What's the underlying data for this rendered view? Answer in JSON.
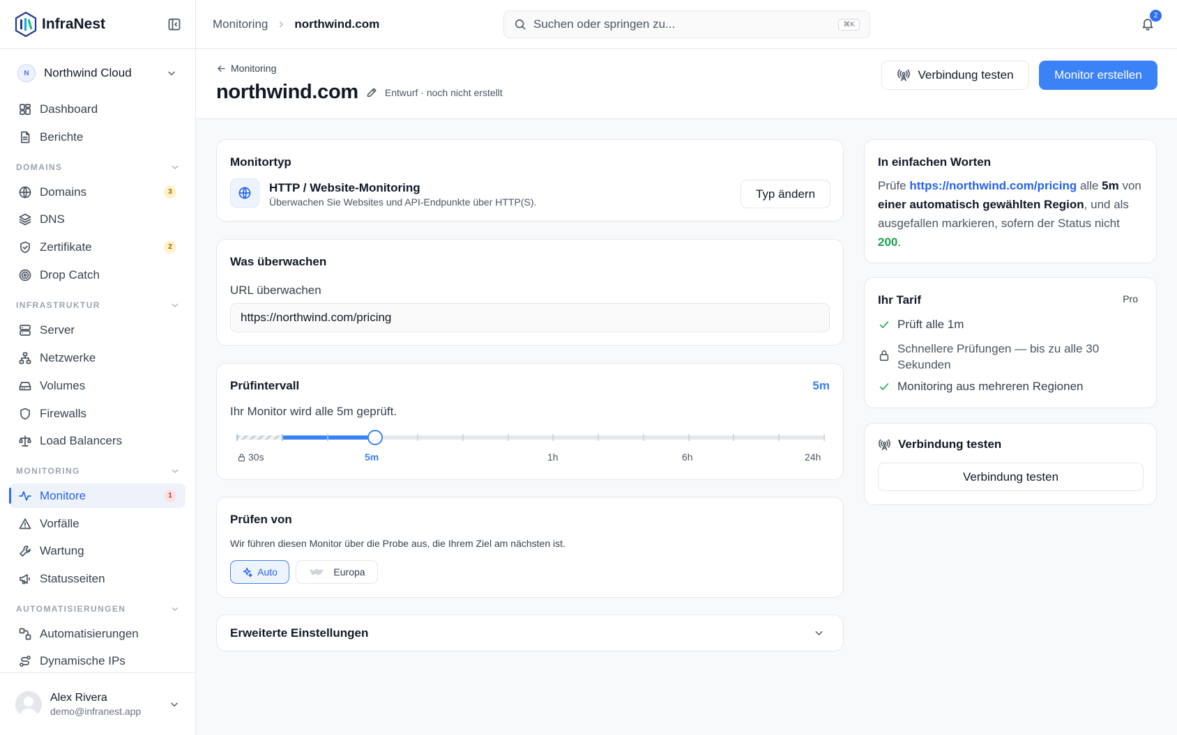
{
  "brand": {
    "name": "InfraNest"
  },
  "org": {
    "initial": "N",
    "name": "Northwind Cloud"
  },
  "nav": {
    "dashboard": "Dashboard",
    "reports": "Berichte",
    "domains_section": "DOMAINS",
    "domains": "Domains",
    "domains_badge": "3",
    "dns": "DNS",
    "certs": "Zertifikate",
    "certs_badge": "2",
    "dropcatch": "Drop Catch",
    "infra_section": "INFRASTRUKTUR",
    "server": "Server",
    "networks": "Netzwerke",
    "volumes": "Volumes",
    "firewalls": "Firewalls",
    "lb": "Load Balancers",
    "monitoring_section": "MONITORING",
    "monitors": "Monitore",
    "monitors_badge": "1",
    "incidents": "Vorfälle",
    "maintenance": "Wartung",
    "statuspages": "Statusseiten",
    "auto_section": "AUTOMATISIERUNGEN",
    "automations": "Automatisierungen",
    "dynips": "Dynamische IPs"
  },
  "user": {
    "name": "Alex Rivera",
    "email": "demo@infranest.app"
  },
  "topbar": {
    "crumb1": "Monitoring",
    "crumb2": "northwind.com",
    "search_placeholder": "Suchen oder springen zu...",
    "search_kbd": "⌘K",
    "notif_count": "2"
  },
  "header": {
    "back": "Monitoring",
    "title": "northwind.com",
    "status": "Entwurf · noch nicht erstellt",
    "test_btn": "Verbindung testen",
    "create_btn": "Monitor erstellen"
  },
  "monitor_type": {
    "title": "Monitortyp",
    "name": "HTTP / Website-Monitoring",
    "desc": "Überwachen Sie Websites und API-Endpunkte über HTTP(S).",
    "change_btn": "Typ ändern"
  },
  "what": {
    "title": "Was überwachen",
    "label": "URL überwachen",
    "value": "https://northwind.com/pricing"
  },
  "interval": {
    "title": "Prüfintervall",
    "current": "5m",
    "desc": "Ihr Monitor wird alle 5m geprüft.",
    "position": 0.235,
    "ticks": [
      "30s",
      "5m",
      "1h",
      "6h",
      "24h"
    ]
  },
  "from": {
    "title": "Prüfen von",
    "desc": "Wir führen diesen Monitor über die Probe aus, die Ihrem Ziel am nächsten ist.",
    "opt_auto": "Auto",
    "opt_europe": "Europa"
  },
  "advanced": {
    "title": "Erweiterte Einstellungen"
  },
  "summary": {
    "title": "In einfachen Worten",
    "p1": "Prüfe ",
    "url": "https://northwind.com/pricing",
    "p2": " alle ",
    "interval": "5m",
    "p3": " von ",
    "region": "einer automatisch gewählten Region",
    "p4": ", und als ausgefallen markieren, sofern der Status nicht ",
    "status": "200",
    "p5": "."
  },
  "plan": {
    "title": "Ihr Tarif",
    "tier": "Pro",
    "f1": "Prüft alle 1m",
    "f2": "Schnellere Prüfungen — bis zu alle 30 Sekunden",
    "f3": "Monitoring aus mehreren Regionen"
  },
  "test": {
    "title": "Verbindung testen",
    "btn": "Verbindung testen"
  },
  "colors": {
    "accent": "#3b82f6",
    "success": "#16a34a"
  }
}
